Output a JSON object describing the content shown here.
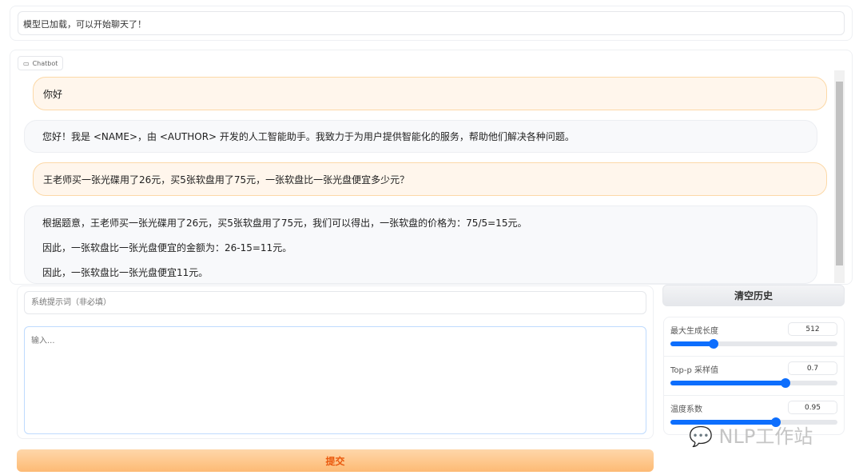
{
  "status": "模型已加载，可以开始聊天了！",
  "chatbot": {
    "label": "Chatbot",
    "messages": [
      {
        "role": "user",
        "lines": [
          "你好"
        ]
      },
      {
        "role": "bot",
        "lines": [
          "您好！我是 <NAME>，由 <AUTHOR> 开发的人工智能助手。我致力于为用户提供智能化的服务，帮助他们解决各种问题。"
        ]
      },
      {
        "role": "user",
        "lines": [
          "王老师买一张光碟用了26元，买5张软盘用了75元，一张软盘比一张光盘便宜多少元？"
        ]
      },
      {
        "role": "bot",
        "lines": [
          "根据题意，王老师买一张光碟用了26元，买5张软盘用了75元，我们可以得出，一张软盘的价格为：75/5=15元。",
          "因此，一张软盘比一张光盘便宜的金额为：26-15=11元。",
          "因此，一张软盘比一张光盘便宜11元。"
        ]
      }
    ]
  },
  "system_prompt": {
    "placeholder": "系统提示词（非必填）"
  },
  "input": {
    "placeholder": "输入..."
  },
  "submit_label": "提交",
  "clear_label": "清空历史",
  "sliders": [
    {
      "label": "最大生成长度",
      "value": "512",
      "fraction": 0.26
    },
    {
      "label": "Top-p 采样值",
      "value": "0.7",
      "fraction": 0.69
    },
    {
      "label": "温度系数",
      "value": "0.95",
      "fraction": 0.63
    }
  ],
  "watermark": "NLP工作站",
  "colors": {
    "accent": "#0d6efd",
    "submit": "#fdba74",
    "user_bubble": "#fff6ec"
  }
}
